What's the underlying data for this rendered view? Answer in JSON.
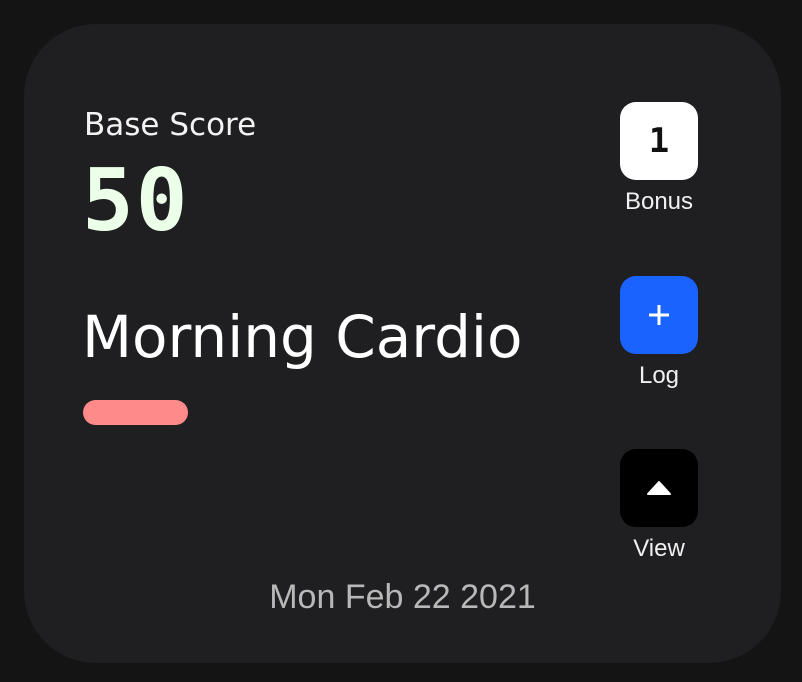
{
  "card": {
    "base_score_label": "Base Score",
    "base_score_value": "50",
    "workout_name": "Morning Cardio",
    "accent_color": "#ff8a8a",
    "date": "Mon Feb 22 2021"
  },
  "actions": {
    "bonus": {
      "value": "1",
      "label": "Bonus"
    },
    "log": {
      "icon": "plus-icon",
      "label": "Log",
      "color": "#1a63ff"
    },
    "view": {
      "icon": "triangle-up-icon",
      "label": "View"
    }
  }
}
